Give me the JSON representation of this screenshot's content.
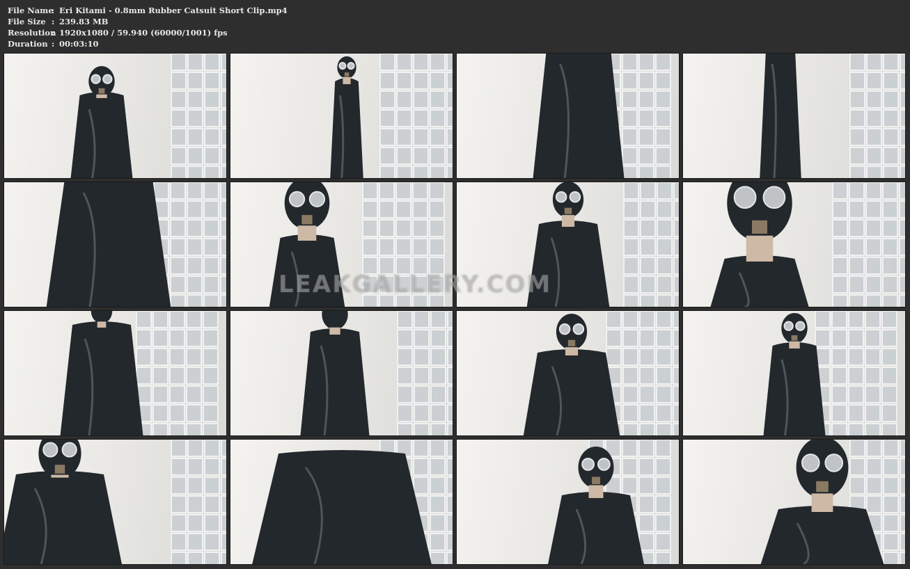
{
  "info": {
    "rows": [
      {
        "label": "File Name",
        "sep": ":",
        "value": "Eri Kitami - 0.8mm Rubber Catsuit Short Clip.mp4"
      },
      {
        "label": "File Size",
        "sep": ":",
        "value": "239.83 MB"
      },
      {
        "label": "Resolution",
        "sep": ":",
        "value": "1920x1080 / 59.940 (60000/1001) fps"
      },
      {
        "label": "Duration",
        "sep": ":",
        "value": "00:03:10"
      }
    ]
  },
  "watermark": "LEAKGALLERY.COM",
  "colors": {
    "background": "#2e2e2e",
    "text": "#e8e8e8",
    "latex": "#23282d",
    "wall": "#eeeeea",
    "glass": "#c9ced2"
  },
  "thumbnails": [
    {
      "subject": "gasmask-front-hand-at-mask",
      "glass_side": "right"
    },
    {
      "subject": "gasmask-full-standing-hands-at-mask",
      "glass_side": "right"
    },
    {
      "subject": "back-view-torso",
      "glass_side": "right"
    },
    {
      "subject": "legs-boots",
      "glass_side": "right"
    },
    {
      "subject": "arms-crossed-torso",
      "glass_side": "right"
    },
    {
      "subject": "gasmask-side-profile",
      "glass_side": "right"
    },
    {
      "subject": "gasmask-front-upper-body",
      "glass_side": "right"
    },
    {
      "subject": "gasmask-closeup-profile",
      "glass_side": "right"
    },
    {
      "subject": "back-view-standing",
      "glass_side": "right"
    },
    {
      "subject": "bending-forward",
      "glass_side": "right"
    },
    {
      "subject": "gasmask-crouching",
      "glass_side": "right"
    },
    {
      "subject": "gasmask-crouching-diagonal",
      "glass_side": "right"
    },
    {
      "subject": "gasmask-leaning-crouch",
      "glass_side": "right"
    },
    {
      "subject": "squatting-legs-apart",
      "glass_side": "right"
    },
    {
      "subject": "gasmask-hands-behind-head",
      "glass_side": "right"
    },
    {
      "subject": "gasmask-closeup-upper-body",
      "glass_side": "right"
    }
  ]
}
